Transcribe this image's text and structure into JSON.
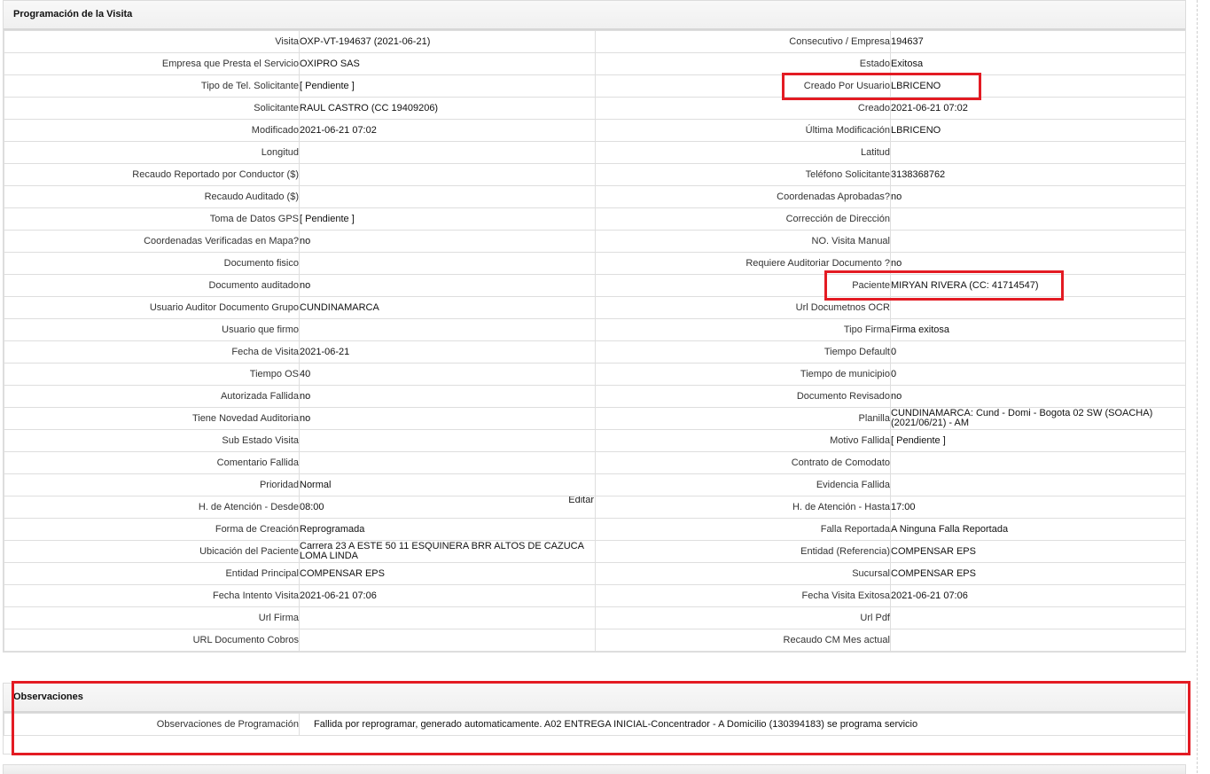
{
  "visit_panel": {
    "title": "Programación de la Visita",
    "rows": [
      [
        {
          "label": "Visita",
          "value": "OXP-VT-194637 (2021-06-21)"
        },
        {
          "label": "Consecutivo / Empresa",
          "value": "194637"
        }
      ],
      [
        {
          "label": "Empresa que Presta el Servicio",
          "value": "OXIPRO SAS"
        },
        {
          "label": "Estado",
          "value": "Exitosa"
        }
      ],
      [
        {
          "label": "Tipo de Tel. Solicitante",
          "value": "[ Pendiente ]"
        },
        {
          "label": "Creado Por Usuario",
          "value": "LBRICENO"
        }
      ],
      [
        {
          "label": "Solicitante",
          "value": "RAUL CASTRO (CC 19409206)"
        },
        {
          "label": "Creado",
          "value": "2021-06-21 07:02"
        }
      ],
      [
        {
          "label": "Modificado",
          "value": "2021-06-21 07:02"
        },
        {
          "label": "Última Modificación",
          "value": " LBRICENO"
        }
      ],
      [
        {
          "label": "Longitud",
          "value": ""
        },
        {
          "label": "Latitud",
          "value": ""
        }
      ],
      [
        {
          "label": "Recaudo Reportado por Conductor ($)",
          "value": ""
        },
        {
          "label": "Teléfono Solicitante",
          "value": "3138368762"
        }
      ],
      [
        {
          "label": "Recaudo Auditado ($)",
          "value": ""
        },
        {
          "label": "Coordenadas Aprobadas?",
          "value": " no"
        }
      ],
      [
        {
          "label": "Toma de Datos GPS",
          "value": "[ Pendiente ]"
        },
        {
          "label": "Corrección de Dirección",
          "value": ""
        }
      ],
      [
        {
          "label": "Coordenadas Verificadas en Mapa?",
          "value": " no"
        },
        {
          "label": "NO. Visita Manual",
          "value": ""
        }
      ],
      [
        {
          "label": "Documento fisico",
          "value": ""
        },
        {
          "label": "Requiere Auditoriar Documento ?",
          "value": " no"
        }
      ],
      [
        {
          "label": "Documento auditado",
          "value": " no"
        },
        {
          "label": "Paciente",
          "value": "MIRYAN RIVERA (CC: 41714547)"
        }
      ],
      [
        {
          "label": "Usuario Auditor Documento Grupo",
          "value": "CUNDINAMARCA"
        },
        {
          "label": "Url Documetnos OCR",
          "value": ""
        }
      ],
      [
        {
          "label": "Usuario que firmo",
          "value": ""
        },
        {
          "label": "Tipo Firma",
          "value": "Firma exitosa"
        }
      ],
      [
        {
          "label": "Fecha de Visita",
          "value": " 2021-06-21"
        },
        {
          "label": "Tiempo Default",
          "value": "0"
        }
      ],
      [
        {
          "label": "Tiempo OS",
          "value": "40"
        },
        {
          "label": "Tiempo de municipio",
          "value": "0"
        }
      ],
      [
        {
          "label": "Autorizada Fallida",
          "value": " no"
        },
        {
          "label": "Documento Revisado",
          "value": " no"
        }
      ],
      [
        {
          "label": "Tiene Novedad Auditoria",
          "value": " no"
        },
        {
          "label": "Planilla",
          "value": "CUNDINAMARCA: Cund - Domi - Bogota 02 SW (SOACHA) (2021/06/21) - AM"
        }
      ],
      [
        {
          "label": "Sub Estado Visita",
          "value": ""
        },
        {
          "label": "Motivo Fallida",
          "value": "[ Pendiente ]"
        }
      ],
      [
        {
          "label": "Comentario Fallida",
          "value": ""
        },
        {
          "label": "Contrato de Comodato",
          "value": ""
        }
      ],
      [
        {
          "label": "Prioridad",
          "value": "Normal"
        },
        {
          "label": "Evidencia Fallida",
          "value": ""
        }
      ],
      [
        {
          "label": "H. de Atención - Desde",
          "value": "08:00",
          "extra": "Editar"
        },
        {
          "label": "H. de Atención - Hasta",
          "value": "17:00"
        }
      ],
      [
        {
          "label": "Forma de Creación",
          "value": "Reprogramada"
        },
        {
          "label": "Falla Reportada",
          "value": "A Ninguna Falla Reportada"
        }
      ],
      [
        {
          "label": "Ubicación del Paciente",
          "value": "Carrera 23 A ESTE 50 11 ESQUINERA BRR ALTOS DE CAZUCA LOMA LINDA"
        },
        {
          "label": "Entidad (Referencia)",
          "value": "COMPENSAR EPS"
        }
      ],
      [
        {
          "label": "Entidad Principal",
          "value": "COMPENSAR EPS"
        },
        {
          "label": "Sucursal",
          "value": "COMPENSAR EPS"
        }
      ],
      [
        {
          "label": "Fecha Intento Visita",
          "value": " 2021-06-21 07:06"
        },
        {
          "label": "Fecha Visita Exitosa",
          "value": " 2021-06-21 07:06"
        }
      ],
      [
        {
          "label": "Url Firma",
          "value": ""
        },
        {
          "label": "Url Pdf",
          "value": ""
        }
      ],
      [
        {
          "label": "URL Documento Cobros",
          "value": ""
        },
        {
          "label": "Recaudo CM Mes actual",
          "value": ""
        }
      ]
    ]
  },
  "obs_panel": {
    "title": "Observaciones",
    "label": "Observaciones de Programación",
    "value": "Fallida por reprogramar, generado automaticamente. A02 ENTREGA INICIAL-Concentrador - A Domicilio (130394183) se programa servicio"
  },
  "highlight_color": "#e31b23"
}
